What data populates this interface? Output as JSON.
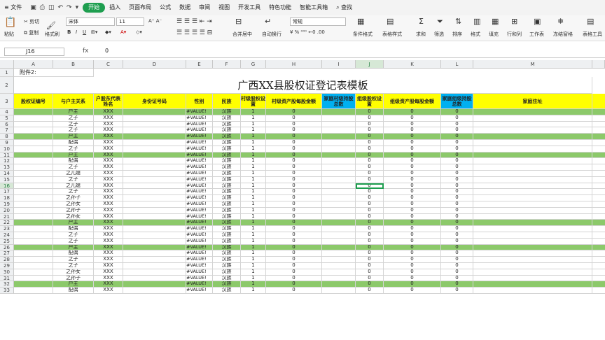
{
  "menu": {
    "file": "文件",
    "tabs": [
      "开始",
      "插入",
      "页面布局",
      "公式",
      "数据",
      "审阅",
      "视图",
      "开发工具",
      "特色功能",
      "智能工具箱"
    ],
    "active_tab": "开始",
    "search": "查找"
  },
  "ribbon": {
    "paste": "粘贴",
    "cut": "剪切",
    "copy": "复制",
    "format_painter": "格式刷",
    "font_name": "宋体",
    "font_size": "11",
    "merge_center": "合并居中",
    "wrap": "自动换行",
    "number_format": "常规",
    "cond_format": "条件格式",
    "table_style": "表格样式",
    "sum": "求和",
    "filter": "筛选",
    "sort": "排序",
    "format": "格式",
    "fill": "填充",
    "row_col": "行和列",
    "worksheet": "工作表",
    "freeze": "冻结窗格",
    "table_tools": "表格工具"
  },
  "formula_bar": {
    "name_box": "J16",
    "fx": "fx",
    "value": "0"
  },
  "columns": [
    "A",
    "B",
    "C",
    "D",
    "E",
    "F",
    "G",
    "H",
    "I",
    "J",
    "K",
    "L",
    "M"
  ],
  "selected_column": "J",
  "selected_row": "16",
  "row1_text": "附件2:",
  "title": "广西XX县股权证登记表模板",
  "headers": [
    "股权证编号",
    "与户主关系",
    "户股东代表姓名",
    "身份证号码",
    "性别",
    "民族",
    "村级股权设置",
    "村级资产股每股金额",
    "家庭村级持股总数",
    "组级股权设置",
    "组级资产股每股金额",
    "家庭组级持股总数",
    "家庭住址"
  ],
  "rows": [
    {
      "n": "4",
      "rel": "户主",
      "name": "XXX",
      "gender": "#VALUE!",
      "nation": "汉族",
      "g": "1",
      "h": "0",
      "j": "0",
      "k": "0",
      "l": "0",
      "green": true
    },
    {
      "n": "5",
      "rel": "之子",
      "name": "XXX",
      "gender": "#VALUE!",
      "nation": "汉族",
      "g": "1",
      "h": "0",
      "j": "0",
      "k": "0",
      "l": "0",
      "green": false
    },
    {
      "n": "6",
      "rel": "之子",
      "name": "XXX",
      "gender": "#VALUE!",
      "nation": "汉族",
      "g": "1",
      "h": "0",
      "j": "0",
      "k": "0",
      "l": "0",
      "green": false
    },
    {
      "n": "7",
      "rel": "之子",
      "name": "XXX",
      "gender": "#VALUE!",
      "nation": "汉族",
      "g": "1",
      "h": "0",
      "j": "0",
      "k": "0",
      "l": "0",
      "green": false
    },
    {
      "n": "8",
      "rel": "户主",
      "name": "XXX",
      "gender": "#VALUE!",
      "nation": "汉族",
      "g": "1",
      "h": "0",
      "j": "0",
      "k": "0",
      "l": "0",
      "green": true
    },
    {
      "n": "9",
      "rel": "配偶",
      "name": "XXX",
      "gender": "#VALUE!",
      "nation": "汉族",
      "g": "1",
      "h": "0",
      "j": "0",
      "k": "0",
      "l": "0",
      "green": false
    },
    {
      "n": "10",
      "rel": "之子",
      "name": "XXX",
      "gender": "#VALUE!",
      "nation": "汉族",
      "g": "1",
      "h": "0",
      "j": "0",
      "k": "0",
      "l": "0",
      "green": false
    },
    {
      "n": "11",
      "rel": "户主",
      "name": "XXX",
      "gender": "#VALUE!",
      "nation": "汉族",
      "g": "1",
      "h": "0",
      "j": "0",
      "k": "0",
      "l": "0",
      "green": true
    },
    {
      "n": "12",
      "rel": "配偶",
      "name": "XXX",
      "gender": "#VALUE!",
      "nation": "汉族",
      "g": "1",
      "h": "0",
      "j": "0",
      "k": "0",
      "l": "0",
      "green": false
    },
    {
      "n": "13",
      "rel": "之子",
      "name": "XXX",
      "gender": "#VALUE!",
      "nation": "汉族",
      "g": "1",
      "h": "0",
      "j": "0",
      "k": "0",
      "l": "0",
      "green": false
    },
    {
      "n": "14",
      "rel": "之儿媳",
      "name": "XXX",
      "gender": "#VALUE!",
      "nation": "汉族",
      "g": "1",
      "h": "0",
      "j": "0",
      "k": "0",
      "l": "0",
      "green": false
    },
    {
      "n": "15",
      "rel": "之子",
      "name": "XXX",
      "gender": "#VALUE!",
      "nation": "汉族",
      "g": "1",
      "h": "0",
      "j": "0",
      "k": "0",
      "l": "0",
      "green": false
    },
    {
      "n": "16",
      "rel": "之儿媳",
      "name": "XXX",
      "gender": "#VALUE!",
      "nation": "汉族",
      "g": "1",
      "h": "0",
      "j": "0",
      "k": "0",
      "l": "0",
      "green": false
    },
    {
      "n": "17",
      "rel": "之子",
      "name": "XXX",
      "gender": "#VALUE!",
      "nation": "汉族",
      "g": "1",
      "h": "0",
      "j": "0",
      "k": "0",
      "l": "0",
      "green": false
    },
    {
      "n": "18",
      "rel": "之孙子",
      "name": "XXX",
      "gender": "#VALUE!",
      "nation": "汉族",
      "g": "1",
      "h": "0",
      "j": "0",
      "k": "0",
      "l": "0",
      "green": false
    },
    {
      "n": "19",
      "rel": "之孙女",
      "name": "XXX",
      "gender": "#VALUE!",
      "nation": "汉族",
      "g": "1",
      "h": "0",
      "j": "0",
      "k": "0",
      "l": "0",
      "green": false
    },
    {
      "n": "20",
      "rel": "之孙子",
      "name": "XXX",
      "gender": "#VALUE!",
      "nation": "汉族",
      "g": "1",
      "h": "0",
      "j": "0",
      "k": "0",
      "l": "0",
      "green": false
    },
    {
      "n": "21",
      "rel": "之孙女",
      "name": "XXX",
      "gender": "#VALUE!",
      "nation": "汉族",
      "g": "1",
      "h": "0",
      "j": "0",
      "k": "0",
      "l": "0",
      "green": false
    },
    {
      "n": "22",
      "rel": "户主",
      "name": "XXX",
      "gender": "#VALUE!",
      "nation": "汉族",
      "g": "1",
      "h": "0",
      "j": "0",
      "k": "0",
      "l": "0",
      "green": true
    },
    {
      "n": "23",
      "rel": "配偶",
      "name": "XXX",
      "gender": "#VALUE!",
      "nation": "汉族",
      "g": "1",
      "h": "0",
      "j": "0",
      "k": "0",
      "l": "0",
      "green": false
    },
    {
      "n": "24",
      "rel": "之子",
      "name": "XXX",
      "gender": "#VALUE!",
      "nation": "汉族",
      "g": "1",
      "h": "0",
      "j": "0",
      "k": "0",
      "l": "0",
      "green": false
    },
    {
      "n": "25",
      "rel": "之子",
      "name": "XXX",
      "gender": "#VALUE!",
      "nation": "汉族",
      "g": "1",
      "h": "0",
      "j": "0",
      "k": "0",
      "l": "0",
      "green": false
    },
    {
      "n": "26",
      "rel": "户主",
      "name": "XXX",
      "gender": "#VALUE!",
      "nation": "汉族",
      "g": "1",
      "h": "0",
      "j": "0",
      "k": "0",
      "l": "0",
      "green": true
    },
    {
      "n": "27",
      "rel": "配偶",
      "name": "XXX",
      "gender": "#VALUE!",
      "nation": "汉族",
      "g": "1",
      "h": "0",
      "j": "0",
      "k": "0",
      "l": "0",
      "green": false
    },
    {
      "n": "28",
      "rel": "之子",
      "name": "XXX",
      "gender": "#VALUE!",
      "nation": "汉族",
      "g": "1",
      "h": "0",
      "j": "0",
      "k": "0",
      "l": "0",
      "green": false
    },
    {
      "n": "29",
      "rel": "之子",
      "name": "XXX",
      "gender": "#VALUE!",
      "nation": "汉族",
      "g": "1",
      "h": "0",
      "j": "0",
      "k": "0",
      "l": "0",
      "green": false
    },
    {
      "n": "30",
      "rel": "之孙女",
      "name": "XXX",
      "gender": "#VALUE!",
      "nation": "汉族",
      "g": "1",
      "h": "0",
      "j": "0",
      "k": "0",
      "l": "0",
      "green": false
    },
    {
      "n": "31",
      "rel": "之孙子",
      "name": "XXX",
      "gender": "#VALUE!",
      "nation": "汉族",
      "g": "1",
      "h": "0",
      "j": "0",
      "k": "0",
      "l": "0",
      "green": false
    },
    {
      "n": "32",
      "rel": "户主",
      "name": "XXX",
      "gender": "#VALUE!",
      "nation": "汉族",
      "g": "1",
      "h": "0",
      "j": "0",
      "k": "0",
      "l": "0",
      "green": true
    },
    {
      "n": "33",
      "rel": "配偶",
      "name": "XXX",
      "gender": "#VALUE!",
      "nation": "汉族",
      "g": "1",
      "h": "0",
      "j": "0",
      "k": "0",
      "l": "0",
      "green": false
    }
  ],
  "colors": {
    "header_yellow": "#ffff00",
    "header_cyan": "#00b0f0",
    "household_green": "#8cc96a",
    "accent": "#1e9e4f"
  }
}
